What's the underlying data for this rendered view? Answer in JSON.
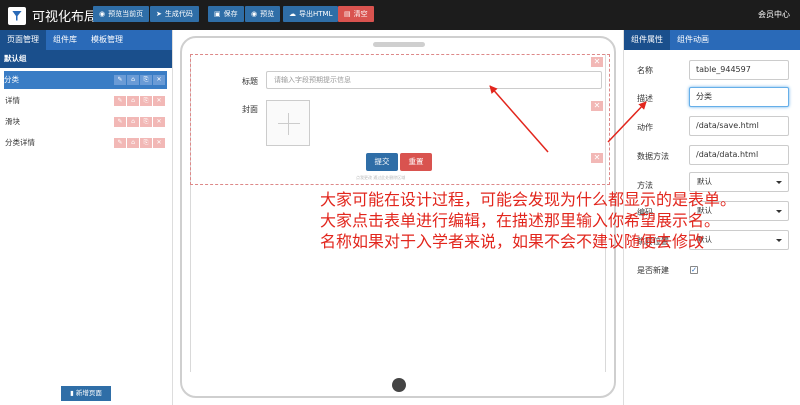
{
  "app": {
    "title": "可视化布局"
  },
  "toolbar": {
    "preview_current": "预览当前页",
    "generate_code": "生成代码",
    "save": "保存",
    "preview": "预览",
    "export_html": "导出HTML",
    "clear": "清空",
    "user_center": "会员中心"
  },
  "left_panel": {
    "tabs": [
      "页面管理",
      "组件库",
      "模板管理"
    ],
    "group_title": "默认组",
    "pages": [
      "分类",
      "详情",
      "滑块",
      "分类详情"
    ],
    "new_page": "新增页面"
  },
  "canvas": {
    "form": {
      "title_label": "标题",
      "title_placeholder": "请输入字段预期提示信息",
      "cover_label": "封面",
      "submit": "提交",
      "reset": "重置",
      "hint": "点我更改    通过此处删除区域"
    }
  },
  "right_panel": {
    "tabs": [
      "组件属性",
      "组件动画"
    ],
    "props": {
      "name_label": "名称",
      "name_value": "table_944597",
      "desc_label": "描述",
      "desc_value": "分类",
      "action_label": "动作",
      "action_value": "/data/save.html",
      "data_method_label": "数据方法",
      "data_method_value": "/data/data.html",
      "method_label": "方法",
      "method_value": "默认",
      "encoding_label": "编码",
      "encoding_value": "默认",
      "target_label": "跳转位置",
      "target_value": "默认",
      "is_new_label": "是否新建",
      "is_new_checked": "✓"
    }
  },
  "annotation": {
    "lines": [
      "大家可能在设计过程，可能会发现为什么都显示的是表单。",
      "大家点击表单进行编辑，在描述那里输入你希望展示名。",
      "名称如果对于入学者来说，如果不会不建议随便去修改"
    ],
    "color": "#e2261d"
  }
}
